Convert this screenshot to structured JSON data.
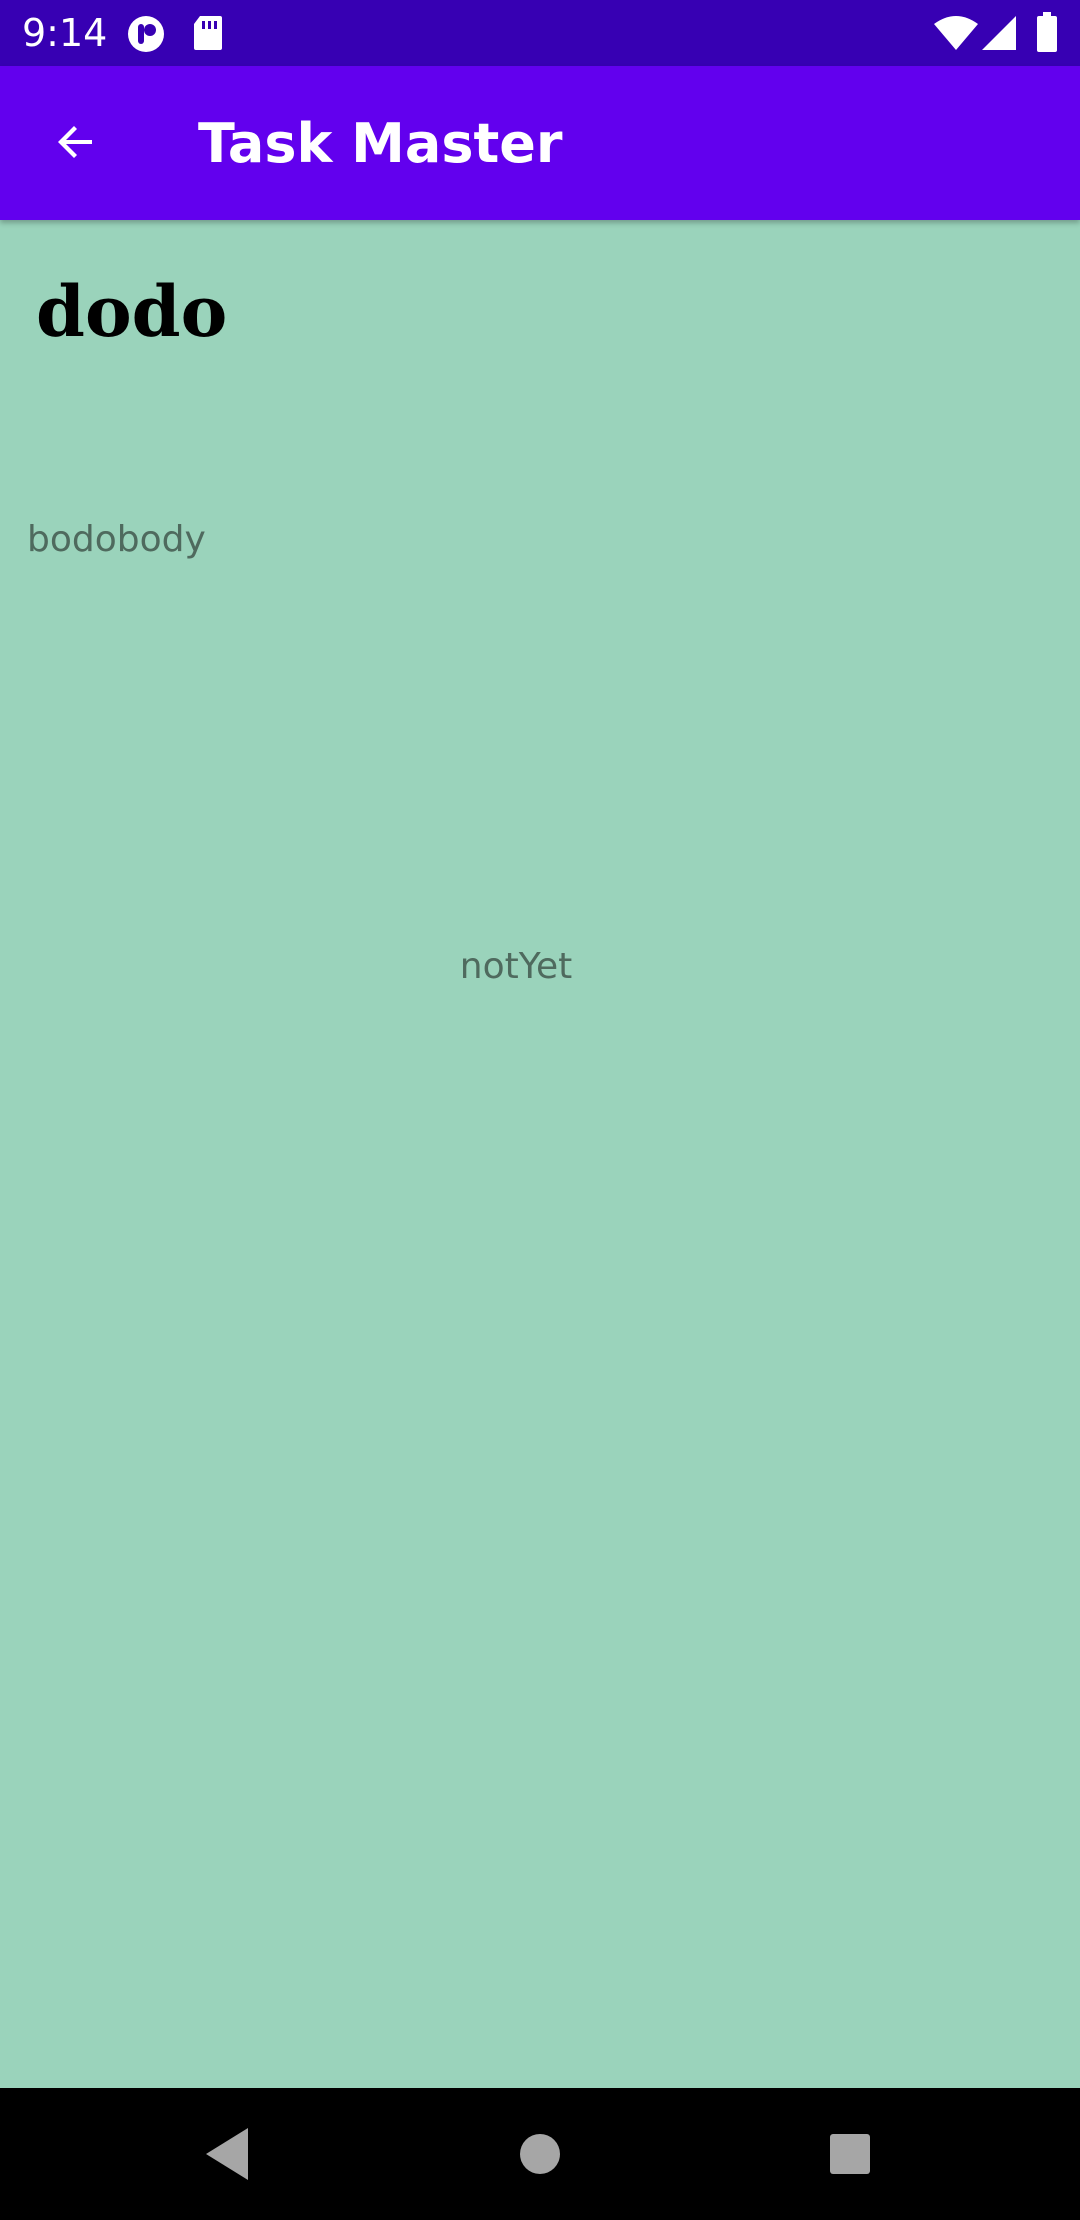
{
  "status_bar": {
    "time": "9:14",
    "icons": [
      "notification-app-icon",
      "sd-card-icon",
      "wifi-icon",
      "signal-icon",
      "battery-icon"
    ]
  },
  "app_bar": {
    "title": "Task Master",
    "back_icon": "arrow-back-icon"
  },
  "task": {
    "title": "dodo",
    "body": "bodobody",
    "state": "notYet"
  },
  "nav_bar": {
    "buttons": [
      "back-triangle-icon",
      "home-circle-icon",
      "recents-square-icon"
    ]
  },
  "colors": {
    "status_bar": "#3700b3",
    "app_bar": "#6200ee",
    "background": "#9ad3bb",
    "nav_bar": "#000000",
    "secondary_text": "#4f6a5e"
  }
}
